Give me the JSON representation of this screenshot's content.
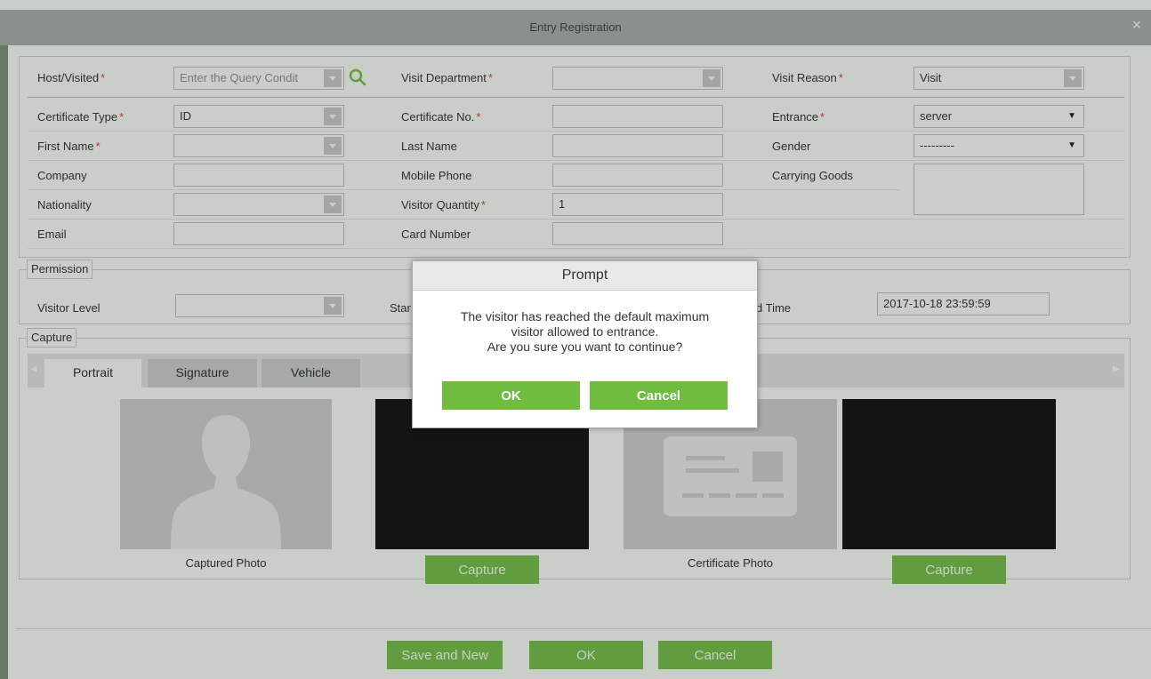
{
  "window": {
    "title": "Entry Registration",
    "close_glyph": "×"
  },
  "form": {
    "host_visited": {
      "label": "Host/Visited",
      "required": "*",
      "placeholder": "Enter the Query Condit"
    },
    "visit_department": {
      "label": "Visit Department",
      "required": "*",
      "value": ""
    },
    "visit_reason": {
      "label": "Visit Reason",
      "required": "*",
      "value": "Visit"
    },
    "certificate_type": {
      "label": "Certificate Type",
      "required": "*",
      "value": "ID"
    },
    "certificate_no": {
      "label": "Certificate No.",
      "required": "*",
      "value": ""
    },
    "entrance": {
      "label": "Entrance",
      "required": "*",
      "value": "server"
    },
    "first_name": {
      "label": "First Name",
      "required": "*",
      "value": ""
    },
    "last_name": {
      "label": "Last Name",
      "value": ""
    },
    "gender": {
      "label": "Gender",
      "value": "---------"
    },
    "company": {
      "label": "Company",
      "value": ""
    },
    "mobile_phone": {
      "label": "Mobile Phone",
      "value": ""
    },
    "carrying_goods": {
      "label": "Carrying Goods",
      "value": ""
    },
    "nationality": {
      "label": "Nationality",
      "value": ""
    },
    "visitor_quantity": {
      "label": "Visitor Quantity",
      "required": "*",
      "value": "1"
    },
    "email": {
      "label": "Email",
      "value": ""
    },
    "card_number": {
      "label": "Card Number",
      "value": ""
    }
  },
  "permission": {
    "legend": "Permission",
    "visitor_level": {
      "label": "Visitor Level",
      "value": ""
    },
    "start_time_label_fragment": "Star",
    "end_time": {
      "label_fragment": "d Time",
      "value": "2017-10-18 23:59:59"
    }
  },
  "capture": {
    "legend": "Capture",
    "tabs": [
      "Portrait",
      "Signature",
      "Vehicle"
    ],
    "active_tab": "Portrait",
    "captured_photo_caption": "Captured Photo",
    "certificate_photo_caption": "Certificate Photo",
    "capture_button_label": "Capture"
  },
  "footer": {
    "save_new_label": "Save and New",
    "ok_label": "OK",
    "cancel_label": "Cancel"
  },
  "prompt": {
    "title": "Prompt",
    "message_lines": [
      "The visitor has reached the default maximum",
      "visitor allowed to entrance.",
      "Are you sure you want to continue?"
    ],
    "ok_label": "OK",
    "cancel_label": "Cancel"
  },
  "colors": {
    "accent_green": "#6fbc3f",
    "required_red": "#e0303a",
    "titlebar": "#a8aaa8"
  },
  "icons": {
    "search": "search-icon",
    "close": "close-icon"
  }
}
